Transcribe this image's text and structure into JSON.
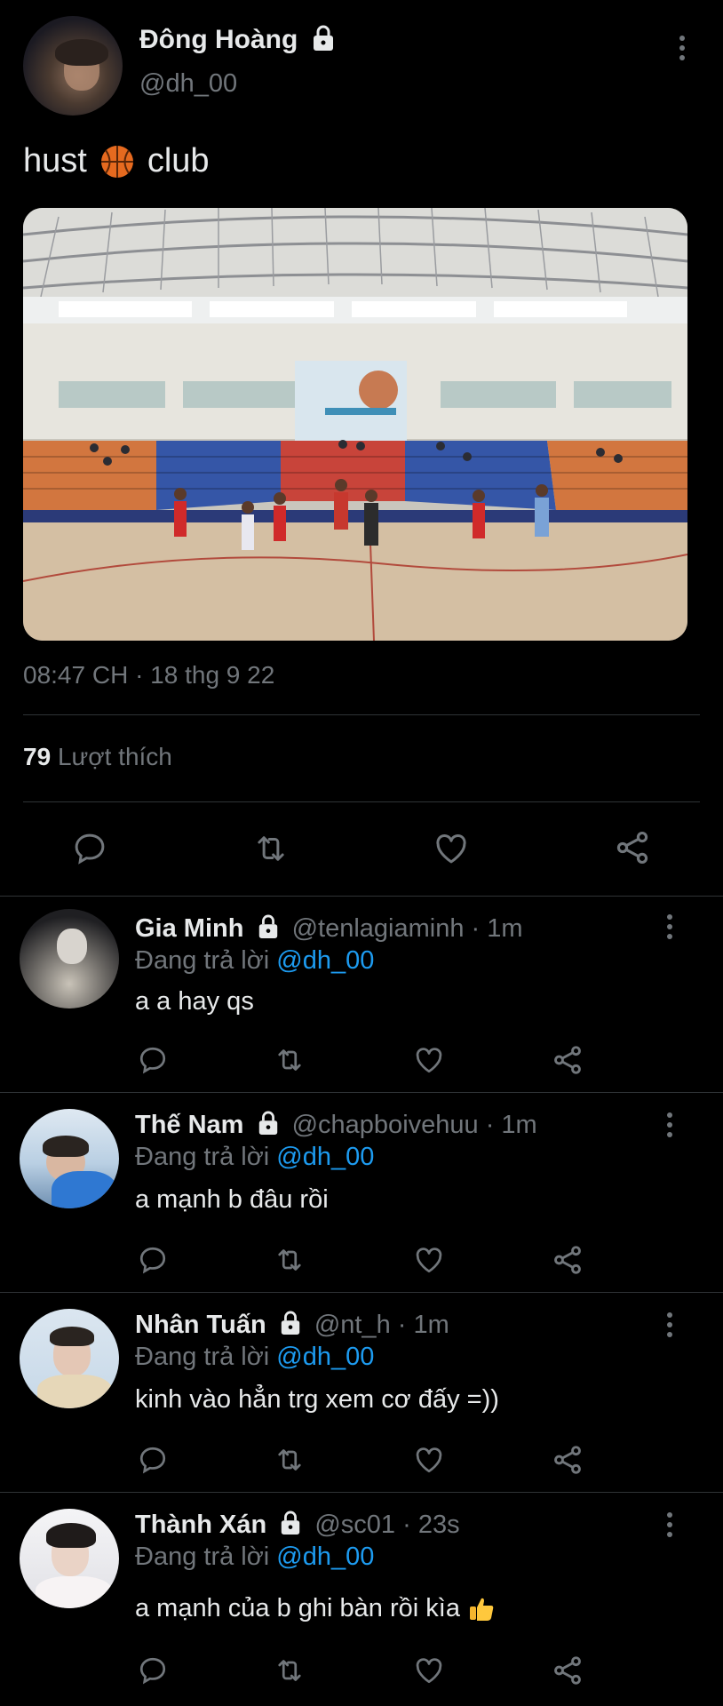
{
  "post": {
    "author_name": "Đông Hoàng",
    "author_handle": "@dh_00",
    "text_before": "hust",
    "text_after": "club",
    "emoji": "basketball-emoji",
    "timestamp": "08:47 CH · 18 thg 9 22",
    "likes_count": "79",
    "likes_label": "Lượt thích"
  },
  "replies": [
    {
      "name": "Gia Minh",
      "handle": "@tenlagiaminh",
      "time": "· 1m",
      "replying_label": "Đang trả lời",
      "replying_to": "@dh_00",
      "text": "a a hay qs"
    },
    {
      "name": "Thế Nam",
      "handle": "@chapboivehuu",
      "time": "· 1m",
      "replying_label": "Đang trả lời",
      "replying_to": "@dh_00",
      "text": "a mạnh b đâu rồi"
    },
    {
      "name": "Nhân Tuấn",
      "handle": "@nt_h",
      "time": "· 1m",
      "replying_label": "Đang trả lời",
      "replying_to": "@dh_00",
      "text": "kinh vào hẳn trg xem cơ đấy =))"
    },
    {
      "name": "Thành Xán",
      "handle": "@sc01",
      "time": "· 23s",
      "replying_label": "Đang trả lời",
      "replying_to": "@dh_00",
      "text": "a mạnh của b ghi bàn rồi kìa",
      "emoji": "thumbs-up-emoji"
    }
  ],
  "icons": [
    "lock-icon",
    "more-icon",
    "reply-icon",
    "retweet-icon",
    "like-icon",
    "share-icon"
  ],
  "colors": {
    "background": "#000000",
    "text": "#e7e9ea",
    "secondary": "#71767b",
    "accent": "#1d9bf0",
    "divider": "#2f3336"
  }
}
